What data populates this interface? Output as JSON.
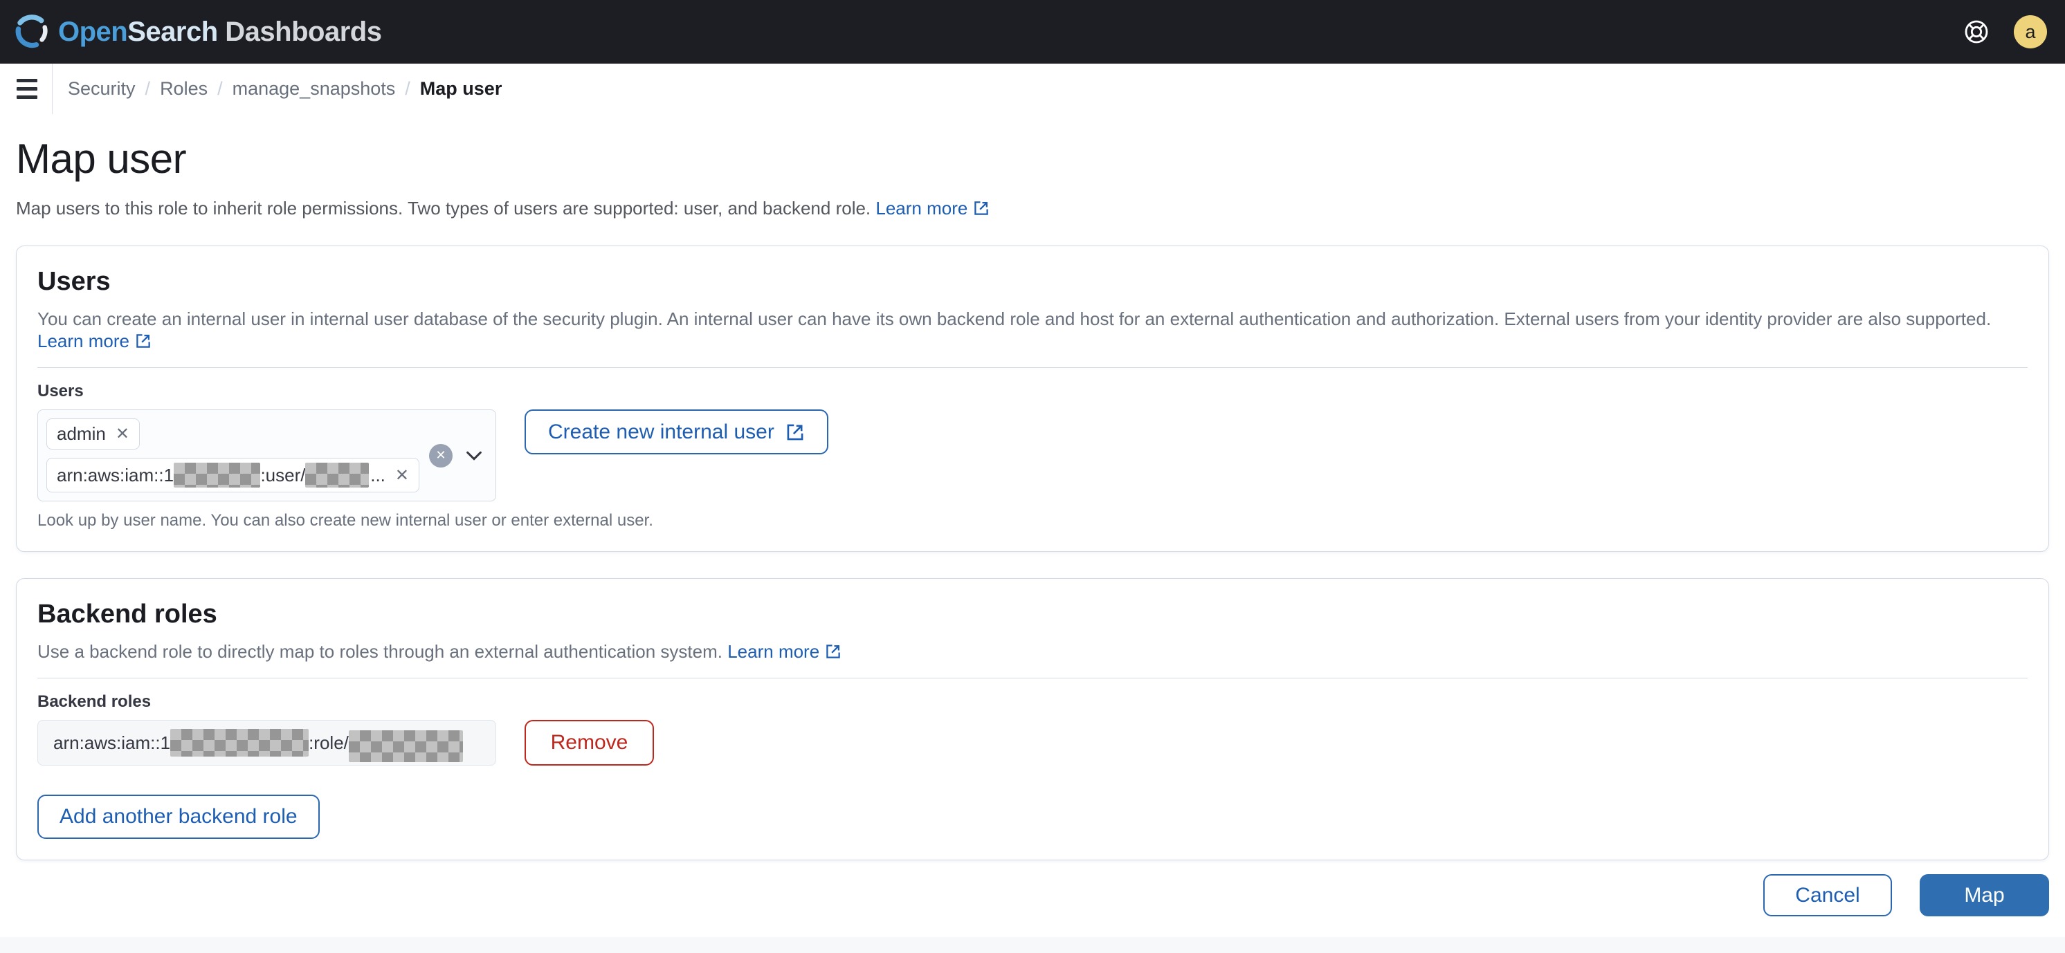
{
  "header": {
    "brand": {
      "open": "Open",
      "search": "Search",
      "dashboards": " Dashboards"
    },
    "avatar_initial": "a"
  },
  "breadcrumbs": {
    "separator": "/",
    "items": [
      {
        "label": "Security"
      },
      {
        "label": "Roles"
      },
      {
        "label": "manage_snapshots"
      },
      {
        "label": "Map user"
      }
    ]
  },
  "page": {
    "title": "Map user",
    "subtitle": "Map users to this role to inherit role permissions. Two types of users are supported: user, and backend role.",
    "learn_more": "Learn more"
  },
  "users_panel": {
    "title": "Users",
    "description": "You can create an internal user in internal user database of the security plugin. An internal user can have its own backend role and host for an external authentication and authorization. External users from your identity provider are also supported.",
    "learn_more": "Learn more",
    "field_label": "Users",
    "tokens": [
      {
        "label": "admin"
      },
      {
        "prefix": "arn:aws:iam::1",
        "middle": ":user/",
        "suffix": "..."
      }
    ],
    "create_button": "Create new internal user",
    "help_text": "Look up by user name. You can also create new internal user or enter external user."
  },
  "backend_panel": {
    "title": "Backend roles",
    "description": "Use a backend role to directly map to roles through an external authentication system.",
    "learn_more": "Learn more",
    "field_label": "Backend roles",
    "input_value_prefix": "arn:aws:iam::1",
    "input_value_middle": ":role/",
    "remove_button": "Remove",
    "add_button": "Add another backend role"
  },
  "footer": {
    "cancel": "Cancel",
    "map": "Map"
  },
  "icons": {
    "close": "✕"
  },
  "colors": {
    "header_bg": "#1d1e24",
    "link_blue": "#1d5db2",
    "primary_fill": "#2f6eb0",
    "danger_red": "#bd271e",
    "avatar_bg": "#efd37b",
    "border": "#d3dae6"
  }
}
